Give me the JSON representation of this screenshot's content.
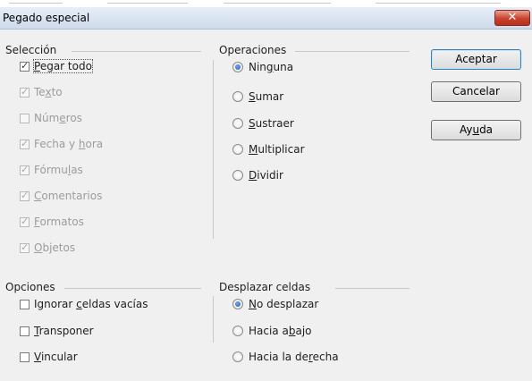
{
  "dialog": {
    "title": "Pegado especial",
    "close_symbol": "✕"
  },
  "seleccion": {
    "title": "Selección",
    "items": [
      {
        "label": "Pegar todo",
        "checked": true,
        "enabled": true
      },
      {
        "label": "Texto",
        "checked": true,
        "enabled": false
      },
      {
        "label": "Números",
        "checked": false,
        "enabled": false
      },
      {
        "label": "Fecha y hora",
        "checked": true,
        "enabled": false
      },
      {
        "label": "Fórmulas",
        "checked": true,
        "enabled": false
      },
      {
        "label": "Comentarios",
        "checked": true,
        "enabled": false
      },
      {
        "label": "Formatos",
        "checked": true,
        "enabled": false
      },
      {
        "label": "Objetos",
        "checked": true,
        "enabled": false
      }
    ]
  },
  "operaciones": {
    "title": "Operaciones",
    "items": [
      {
        "label": "Ninguna",
        "selected": true
      },
      {
        "label": "Sumar",
        "selected": false
      },
      {
        "label": "Sustraer",
        "selected": false
      },
      {
        "label": "Multiplicar",
        "selected": false
      },
      {
        "label": "Dividir",
        "selected": false
      }
    ]
  },
  "opciones": {
    "title": "Opciones",
    "items": [
      {
        "label": "Ignorar celdas vacías",
        "checked": false
      },
      {
        "label": "Transponer",
        "checked": false
      },
      {
        "label": "Vincular",
        "checked": false
      }
    ]
  },
  "desplazar": {
    "title": "Desplazar celdas",
    "items": [
      {
        "label": "No desplazar",
        "selected": true
      },
      {
        "label": "Hacia abajo",
        "selected": false
      },
      {
        "label": "Hacia la derecha",
        "selected": false
      }
    ]
  },
  "buttons": {
    "ok": "Aceptar",
    "cancel": "Cancelar",
    "help": "Ayuda"
  },
  "colors": {
    "accent": "#1f5fb8",
    "close": "#c7422d",
    "background": "#f0f0f0"
  }
}
